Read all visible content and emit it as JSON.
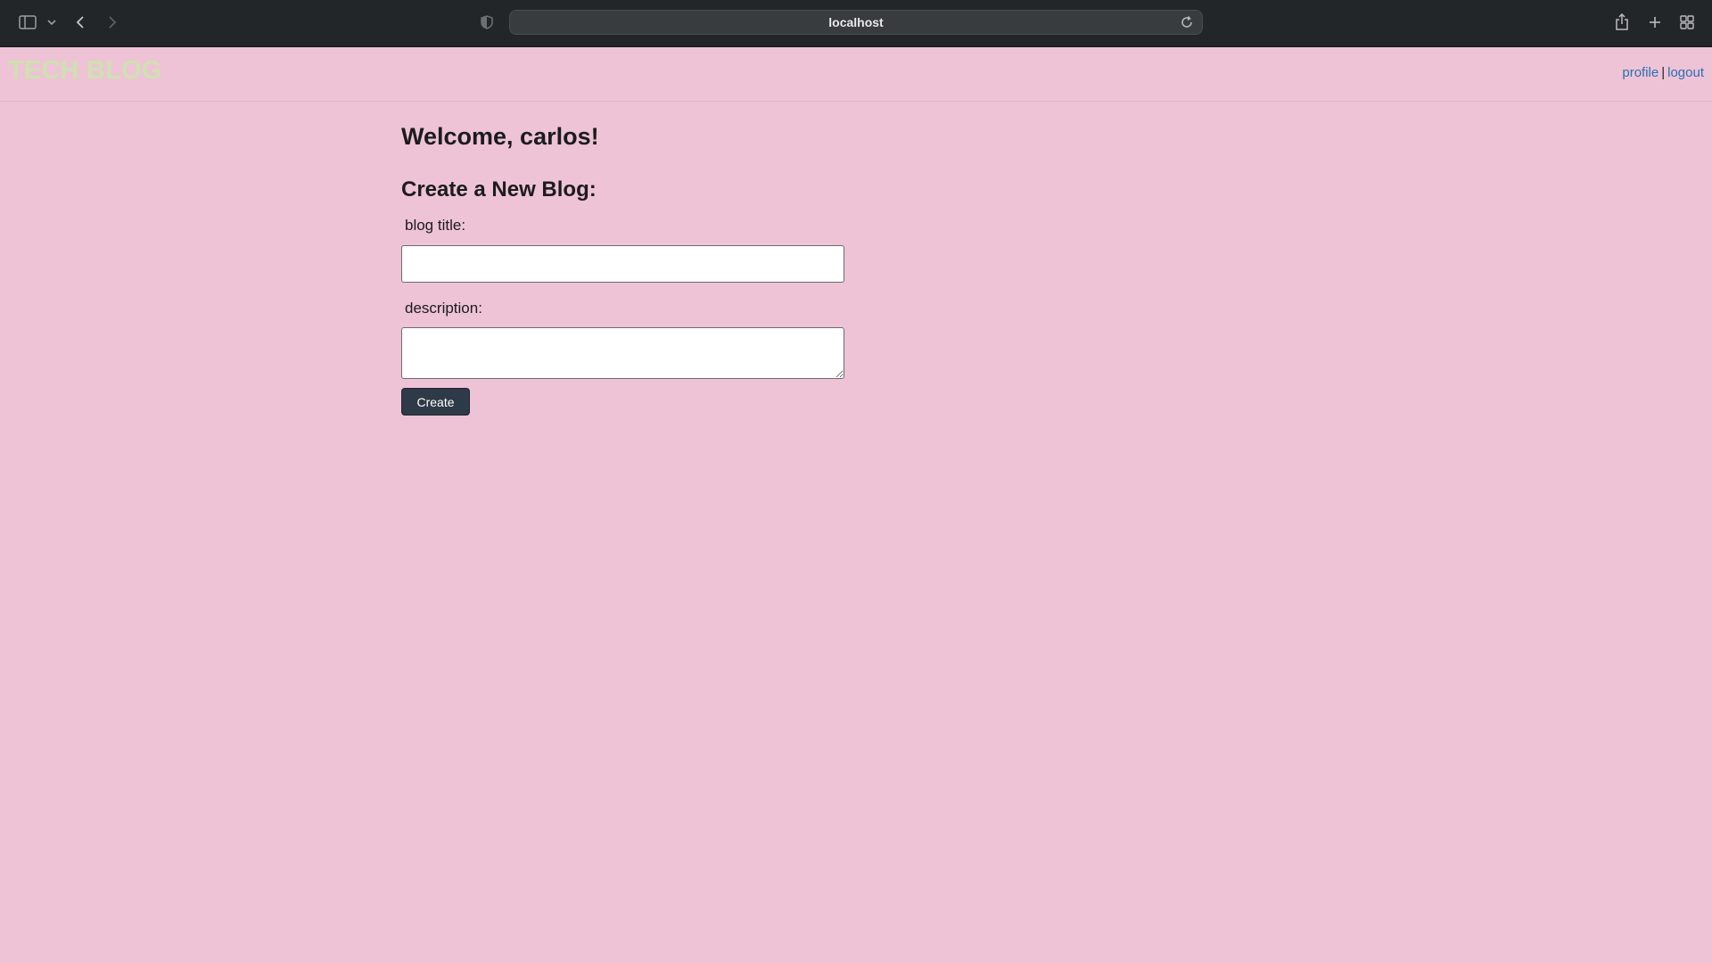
{
  "browser": {
    "url": "localhost",
    "icons": [
      "sidebar-icon",
      "chevron-down-icon",
      "back-arrow-icon",
      "forward-arrow-icon",
      "shield-icon",
      "reload-icon",
      "share-icon",
      "new-tab-icon",
      "tab-overview-icon"
    ]
  },
  "header": {
    "logo": "TECH BLOG",
    "nav": {
      "profile": "profile",
      "separator": "|",
      "logout": "logout"
    }
  },
  "main": {
    "welcome": "Welcome, carlos!",
    "form_title": "Create a New Blog:",
    "fields": {
      "title_label": "blog title:",
      "title_value": "",
      "description_label": "description:",
      "description_value": ""
    },
    "submit_label": "Create"
  },
  "colors": {
    "page_background": "#eec3d6",
    "logo": "#cfe1b0",
    "link": "#2b6fb3",
    "button": "#2e3a47"
  }
}
